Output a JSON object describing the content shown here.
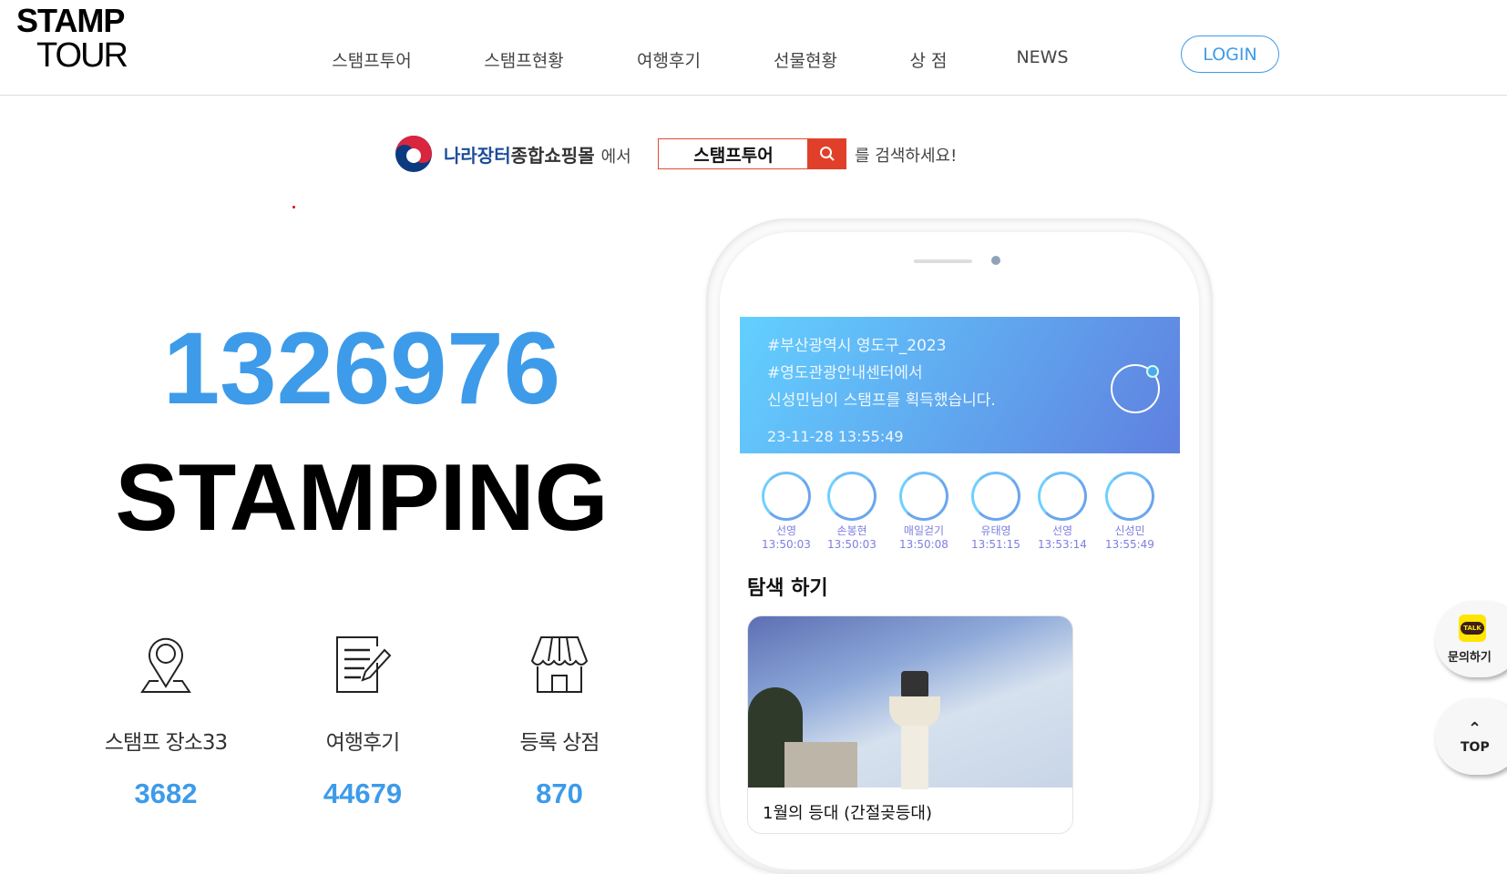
{
  "header": {
    "logo_line1": "STAMP",
    "logo_line2": "TOUR",
    "nav": [
      "스탬프투어",
      "스탬프현황",
      "여행후기",
      "선물현황",
      "상 점",
      "NEWS"
    ],
    "login": "LOGIN"
  },
  "search": {
    "brand_blue": "나라장터",
    "brand_dark": "종합쇼핑몰",
    "in": "에서",
    "value": "스탬프투어",
    "hint": "를 검색하세요!",
    "button_icon": "search-icon"
  },
  "hero": {
    "count": "1326976",
    "label": "STAMPING"
  },
  "stats": [
    {
      "icon": "map-pin-icon",
      "label": "스탬프 장소33",
      "value": "3682"
    },
    {
      "icon": "document-edit-icon",
      "label": "여행후기",
      "value": "44679"
    },
    {
      "icon": "store-icon",
      "label": "등록 상점",
      "value": "870"
    }
  ],
  "phone": {
    "banner": {
      "line1": "#부산광역시 영도구_2023",
      "line2": "#영도관광안내센터에서",
      "line3": "신성민님이 스탬프를 획득했습니다.",
      "time": "23-11-28 13:55:49"
    },
    "recent": [
      {
        "name": "선영",
        "time": "13:50:03"
      },
      {
        "name": "손봉현",
        "time": "13:50:03"
      },
      {
        "name": "매일걷기",
        "time": "13:50:08"
      },
      {
        "name": "유태영",
        "time": "13:51:15"
      },
      {
        "name": "선영",
        "time": "13:53:14"
      },
      {
        "name": "신성민",
        "time": "13:55:49"
      }
    ],
    "explore_title": "탐색 하기",
    "card_title": "1월의 등대 (간절곶등대)"
  },
  "floating": {
    "kakao_badge": "TALK",
    "kakao_label": "문의하기",
    "top_label": "TOP"
  },
  "colors": {
    "accent": "#3d9be9",
    "search_red": "#e0402a",
    "kakao": "#ffe500"
  }
}
